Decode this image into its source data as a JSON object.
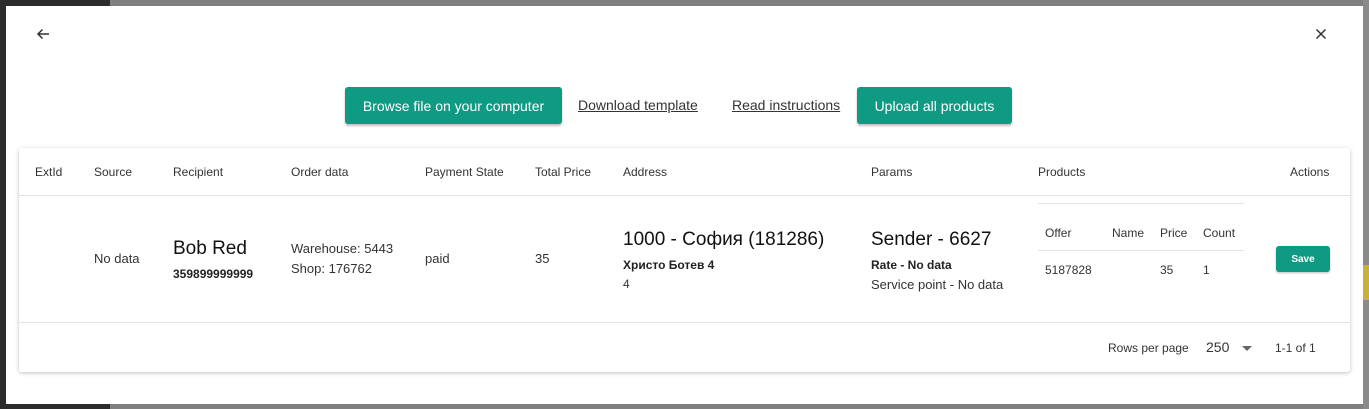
{
  "toolbar": {
    "browse_label": "Browse file on your computer",
    "download_label": "Download template",
    "read_label": "Read instructions",
    "upload_label": "Upload all products"
  },
  "table": {
    "headers": [
      "ExtId",
      "Source",
      "Recipient",
      "Order data",
      "Payment State",
      "Total Price",
      "Address",
      "Params",
      "Products",
      "Actions"
    ],
    "row": {
      "extid": "",
      "source": "No data",
      "recipient_name": "Bob Red",
      "recipient_phone": "359899999999",
      "order_warehouse": "Warehouse: 5443",
      "order_shop": "Shop: 176762",
      "payment_state": "paid",
      "total_price": "35",
      "address_city": "1000 - София (181286)",
      "address_street": "Христо Ботев 4",
      "address_number": "4",
      "params_sender": "Sender - 6627",
      "params_rate": "Rate - No data",
      "params_service_point": "Service point - No data",
      "products": {
        "headers": [
          "Offer",
          "Name",
          "Price",
          "Count"
        ],
        "rows": [
          [
            "5187828",
            "",
            "35",
            "1"
          ]
        ]
      },
      "save_label": "Save"
    }
  },
  "pagination": {
    "rows_per_page_label": "Rows per page",
    "rows_per_page_value": "250",
    "range": "1-1 of 1"
  },
  "icons": {
    "back": "arrow-left-icon",
    "close": "close-icon",
    "dropdown": "caret-down-icon"
  },
  "colors": {
    "primary": "#0f9a84"
  }
}
